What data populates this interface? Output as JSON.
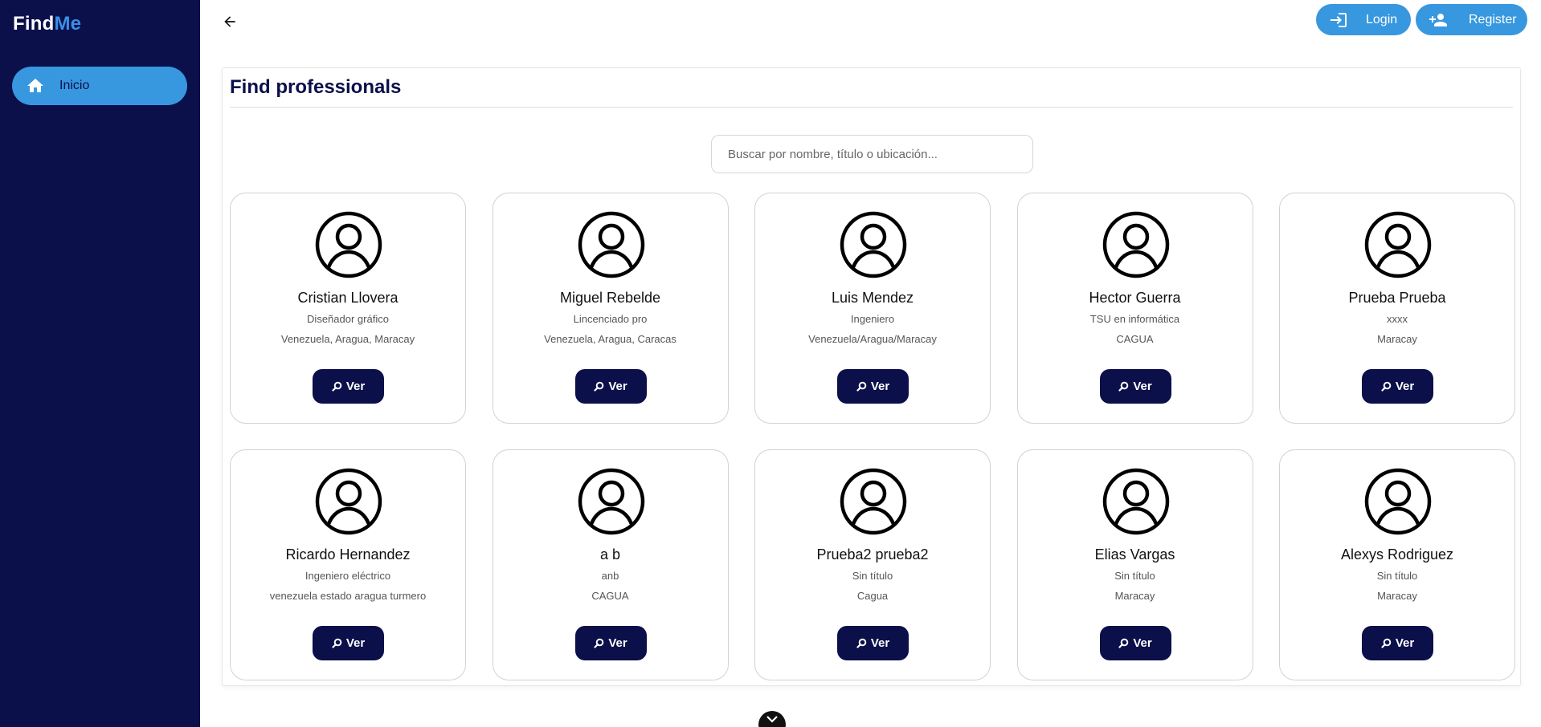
{
  "app": {
    "logo_main": "Find",
    "logo_accent": "Me"
  },
  "sidebar": {
    "items": [
      {
        "label": "Inicio",
        "icon": "home-icon"
      }
    ]
  },
  "header": {
    "login_label": "Login",
    "register_label": "Register"
  },
  "main": {
    "title": "Find professionals",
    "search": {
      "placeholder": "Buscar por nombre, título o ubicación...",
      "value": ""
    },
    "view_label": "Ver",
    "professionals": [
      {
        "name": "Cristian Llovera",
        "title": "Diseñador gráfico",
        "location": "Venezuela, Aragua, Maracay"
      },
      {
        "name": "Miguel Rebelde",
        "title": "Lincenciado pro",
        "location": "Venezuela, Aragua, Caracas"
      },
      {
        "name": "Luis Mendez",
        "title": "Ingeniero",
        "location": "Venezuela/Aragua/Maracay"
      },
      {
        "name": "Hector Guerra",
        "title": "TSU en informática",
        "location": "CAGUA"
      },
      {
        "name": "Prueba Prueba",
        "title": "xxxx",
        "location": "Maracay"
      },
      {
        "name": "Ricardo Hernandez",
        "title": "Ingeniero eléctrico",
        "location": "venezuela estado aragua turmero"
      },
      {
        "name": "a b",
        "title": "anb",
        "location": "CAGUA"
      },
      {
        "name": "Prueba2 prueba2",
        "title": "Sin título",
        "location": "Cagua"
      },
      {
        "name": "Elias Vargas",
        "title": "Sin título",
        "location": "Maracay"
      },
      {
        "name": "Alexys Rodriguez",
        "title": "Sin título",
        "location": "Maracay"
      }
    ]
  },
  "colors": {
    "sidebar_bg": "#0b0f4a",
    "accent": "#3797df",
    "button_dark": "#0b0f4a"
  }
}
